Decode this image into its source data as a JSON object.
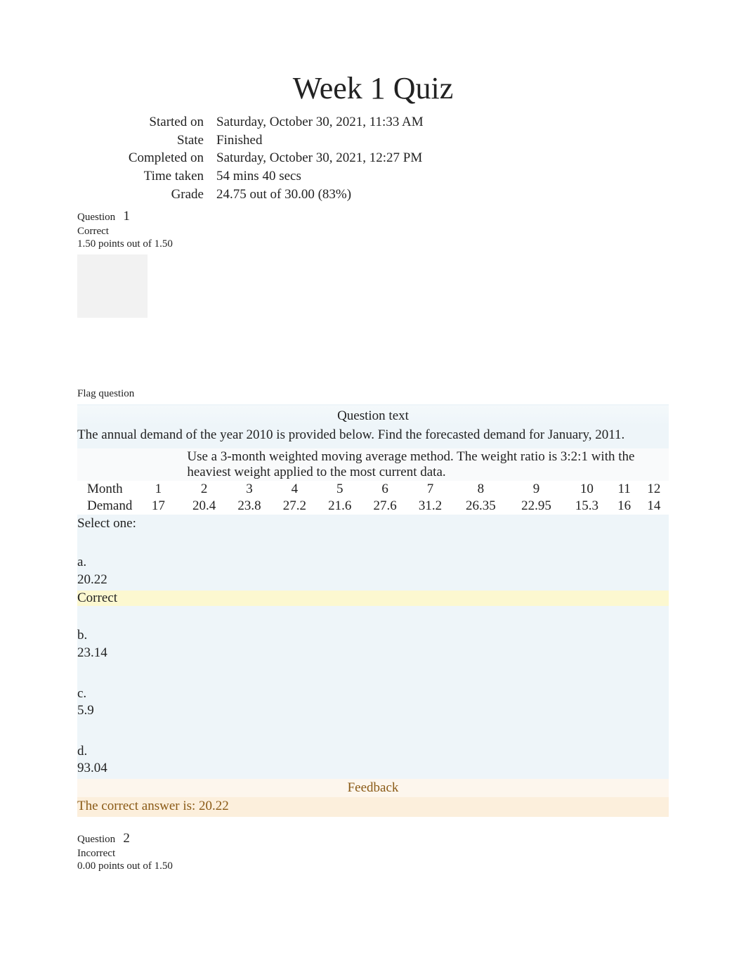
{
  "title": "Week 1 Quiz",
  "summary": {
    "started_label": "Started on",
    "started_value": "Saturday, October 30, 2021, 11:33 AM",
    "state_label": "State",
    "state_value": "Finished",
    "completed_label": "Completed on",
    "completed_value": "Saturday, October 30, 2021, 12:27 PM",
    "time_label": "Time taken",
    "time_value": "54 mins 40 secs",
    "grade_label": "Grade",
    "grade_value": "24.75 out of 30.00 (83%)"
  },
  "q1": {
    "question_label": "Question",
    "number": "1",
    "status": "Correct",
    "points": "1.50 points out of 1.50",
    "flag": "Flag question",
    "heading": "Question text",
    "prompt": "The annual demand of the year 2010 is provided below. Find the forecasted demand for January, 2011.",
    "note": "Use a 3-month weighted moving average method. The weight ratio is 3:2:1 with the heaviest weight applied to the most current data.",
    "table": {
      "row1_label": "Month",
      "months": [
        "1",
        "2",
        "3",
        "4",
        "5",
        "6",
        "7",
        "8",
        "9",
        "10",
        "11",
        "12"
      ],
      "row2_label": "Demand",
      "demand": [
        "17",
        "20.4",
        "23.8",
        "27.2",
        "21.6",
        "27.6",
        "31.2",
        "26.35",
        "22.95",
        "15.3",
        "16",
        "14"
      ]
    },
    "select_one": "Select one:",
    "options": {
      "a_label": "a.",
      "a_value": "20.22",
      "a_correct": "Correct",
      "b_label": "b.",
      "b_value": "23.14",
      "c_label": "c.",
      "c_value": "5.9",
      "d_label": "d.",
      "d_value": "93.04"
    },
    "feedback_heading": "Feedback",
    "feedback_text": "The correct answer is: 20.22"
  },
  "q2": {
    "question_label": "Question",
    "number": "2",
    "status": "Incorrect",
    "points": "0.00 points out of 1.50"
  }
}
